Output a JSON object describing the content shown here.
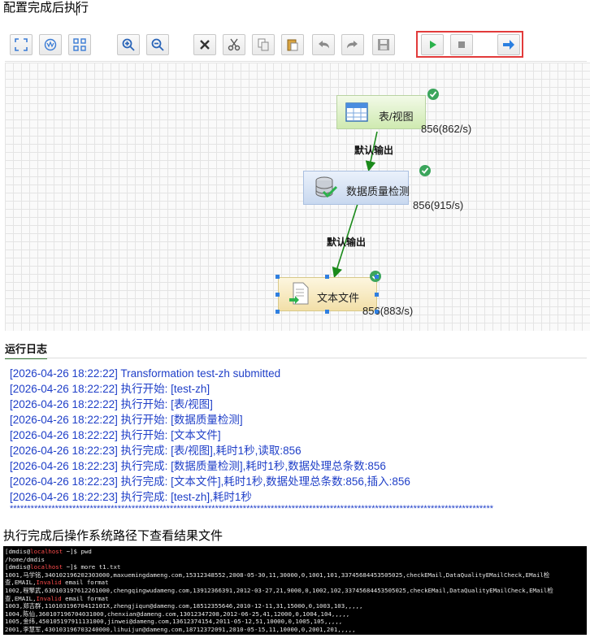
{
  "headings": {
    "top": "配置完成后执行",
    "bottom": "执行完成后操作系统路径下查看结果文件"
  },
  "toolbar": {
    "buttons": [
      {
        "name": "fit-icon"
      },
      {
        "name": "globe-icon"
      },
      {
        "name": "grid-icon"
      },
      {
        "name": "zoom-in-icon"
      },
      {
        "name": "zoom-out-icon"
      },
      {
        "name": "delete-icon"
      },
      {
        "name": "cut-icon"
      },
      {
        "name": "copy-icon"
      },
      {
        "name": "paste-icon"
      },
      {
        "name": "undo-icon"
      },
      {
        "name": "redo-icon"
      },
      {
        "name": "save-icon"
      },
      {
        "name": "run-icon"
      },
      {
        "name": "stop-icon"
      },
      {
        "name": "arrow-right-icon"
      }
    ],
    "highlight_color": "#e23b3b",
    "run_color": "#2bb24c"
  },
  "flow": {
    "nodes": [
      {
        "label": "表/视图",
        "rate": "856(862/s)"
      },
      {
        "label": "数据质量检测",
        "rate": "856(915/s)"
      },
      {
        "label": "文本文件",
        "rate": "856(883/s)"
      }
    ],
    "edges": [
      {
        "label": "默认输出"
      },
      {
        "label": "默认输出"
      }
    ],
    "edge_color": "#1a8a1a"
  },
  "log": {
    "title": "运行日志",
    "lines": [
      "[2026-04-26 18:22:22] Transformation test-zh submitted",
      "[2026-04-26 18:22:22] 执行开始: [test-zh]",
      "[2026-04-26 18:22:22] 执行开始: [表/视图]",
      "[2026-04-26 18:22:22] 执行开始: [数据质量检测]",
      "[2026-04-26 18:22:22] 执行开始: [文本文件]",
      "[2026-04-26 18:22:23] 执行完成: [表/视图],耗时1秒,读取:856",
      "[2026-04-26 18:22:23] 执行完成: [数据质量检测],耗时1秒,数据处理总条数:856",
      "[2026-04-26 18:22:23] 执行完成: [文本文件],耗时1秒,数据处理总条数:856,插入:856",
      "[2026-04-26 18:22:23] 执行完成: [test-zh],耗时1秒"
    ],
    "stars": "*******************************************************************************************************************************************",
    "color": "#1f3fc8"
  },
  "terminal": {
    "lines": [
      {
        "parts": [
          "[dmdis@",
          "localhost",
          " ~]$ pwd"
        ]
      },
      {
        "parts": [
          "/home/dmdis"
        ]
      },
      {
        "parts": [
          "[dmdis@",
          "localhost",
          " ~]$ more t1.txt"
        ]
      },
      {
        "parts": [
          "1001,马学铭,340102196202303000,maxuemingdameng.com,15312348552,2008-05-30,11,30000,0,1001,101,33745684453505025,checkEMail,DataQualityEMailCheck,EMail检"
        ]
      },
      {
        "parts": [
          "查,EMAIL,",
          "Invalid",
          " email format"
        ]
      },
      {
        "parts": [
          "1002,程擎武,630103197612261000,chengqingwudameng.com,13912366391,2012-03-27,21,9000,0,1002,102,33745684453505025,checkEMail,DataQualityEMailCheck,EMail检"
        ]
      },
      {
        "parts": [
          "查,EMAIL,",
          "Invalid",
          " email format"
        ]
      },
      {
        "parts": [
          "1003,郑吉群,1101031967041210IX,zhengjiqun@dameng.com,18512355646,2010-12-11,31,15000,0,1003,103,,,,,"
        ]
      },
      {
        "parts": [
          "1004,陈仙,360107196704031000,chenxian@dameng.com,13012347208,2012-06-25,41,12000,0,1004,104,,,,,"
        ]
      },
      {
        "parts": [
          "1005,金纬,450105197911131000,jinwei@dameng.com,13612374154,2011-05-12,51,10000,0,1005,105,,,,,"
        ]
      },
      {
        "parts": [
          "2001,李慧军,430103196703240000,lihuijun@dameng.com,18712372091,2010-05-15,11,10000,0,2001,201,,,,,"
        ]
      }
    ]
  }
}
